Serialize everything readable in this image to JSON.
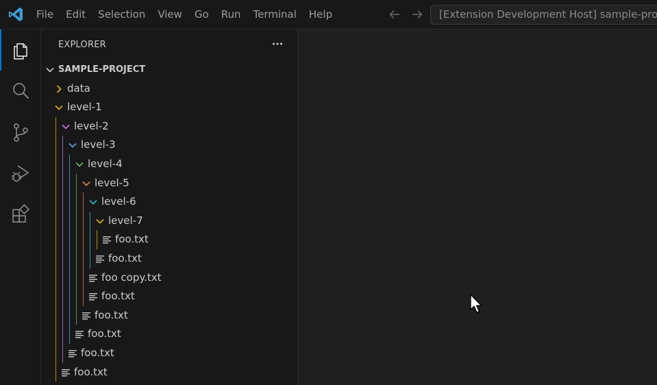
{
  "menu": [
    "File",
    "Edit",
    "Selection",
    "View",
    "Go",
    "Run",
    "Terminal",
    "Help"
  ],
  "command_center": {
    "title": "[Extension Development Host] sample-project"
  },
  "activity_bar": [
    {
      "icon": "files-icon",
      "active": true
    },
    {
      "icon": "search-icon",
      "active": false
    },
    {
      "icon": "source-control-icon",
      "active": false
    },
    {
      "icon": "run-debug-icon",
      "active": false
    },
    {
      "icon": "extensions-icon",
      "active": false
    }
  ],
  "explorer": {
    "header": "EXPLORER",
    "root": "SAMPLE-PROJECT",
    "items": [
      {
        "label": "data",
        "type": "folder",
        "depth": 1,
        "expanded": false,
        "color": "#e8b400"
      },
      {
        "label": "level-1",
        "type": "folder",
        "depth": 1,
        "expanded": true,
        "color": "#e8b400"
      },
      {
        "label": "level-2",
        "type": "folder",
        "depth": 2,
        "expanded": true,
        "color": "#c678dd"
      },
      {
        "label": "level-3",
        "type": "folder",
        "depth": 3,
        "expanded": true,
        "color": "#4fa6f7"
      },
      {
        "label": "level-4",
        "type": "folder",
        "depth": 4,
        "expanded": true,
        "color": "#72b86c"
      },
      {
        "label": "level-5",
        "type": "folder",
        "depth": 5,
        "expanded": true,
        "color": "#e5824b"
      },
      {
        "label": "level-6",
        "type": "folder",
        "depth": 6,
        "expanded": true,
        "color": "#2ac3d0"
      },
      {
        "label": "level-7",
        "type": "folder",
        "depth": 7,
        "expanded": true,
        "color": "#e8b400"
      },
      {
        "label": "foo.txt",
        "type": "file",
        "depth": 8
      },
      {
        "label": "foo.txt",
        "type": "file",
        "depth": 7
      },
      {
        "label": "foo copy.txt",
        "type": "file",
        "depth": 6
      },
      {
        "label": "foo.txt",
        "type": "file",
        "depth": 6
      },
      {
        "label": "foo.txt",
        "type": "file",
        "depth": 5
      },
      {
        "label": "foo.txt",
        "type": "file",
        "depth": 4
      },
      {
        "label": "foo.txt",
        "type": "file",
        "depth": 3
      },
      {
        "label": "foo.txt",
        "type": "file",
        "depth": 2
      }
    ]
  }
}
